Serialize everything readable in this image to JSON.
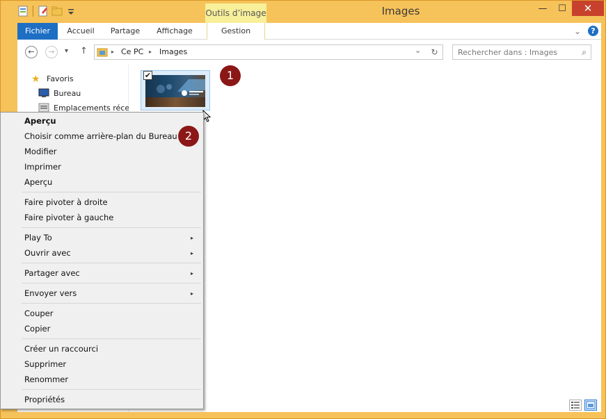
{
  "window": {
    "title": "Images",
    "contextual_tab_group": "Outils d’image",
    "minimize": "—",
    "maximize": "☐",
    "close": "✕"
  },
  "ribbon": {
    "tabs": [
      "Fichier",
      "Accueil",
      "Partage",
      "Affichage",
      "Gestion"
    ],
    "expand_icon": "⌄",
    "help": "?"
  },
  "navigation": {
    "back": "←",
    "forward": "→",
    "recent": "▾",
    "up": "↑",
    "breadcrumb": [
      "Ce PC",
      "Images"
    ],
    "breadcrumb_sep": "▸",
    "dropdown": "⌄",
    "refresh": "↻",
    "search_placeholder": "Rechercher dans : Images",
    "search_icon": "⌕"
  },
  "nav_pane": {
    "favorites": "Favoris",
    "items": [
      "Bureau",
      "Emplacements récents"
    ]
  },
  "files": {
    "selected_check": "✔",
    "callouts": [
      "1",
      "2"
    ]
  },
  "context_menu": {
    "groups": [
      [
        "Aperçu",
        "Choisir comme arrière-plan du Bureau",
        "Modifier",
        "Imprimer",
        "Aperçu"
      ],
      [
        "Faire pivoter à droite",
        "Faire pivoter à gauche"
      ],
      [
        "Play To",
        "Ouvrir avec"
      ],
      [
        "Partager avec"
      ],
      [
        "Envoyer vers"
      ],
      [
        "Couper",
        "Copier"
      ],
      [
        "Créer un raccourci",
        "Supprimer",
        "Renommer"
      ],
      [
        "Propriétés"
      ]
    ],
    "submenu_arrow": "▸"
  },
  "colors": {
    "frame": "#f6c25a",
    "file_tab": "#1e6fc4",
    "tools_tab": "#f8ef9a",
    "close": "#c7412c",
    "callout": "#8b1717"
  }
}
